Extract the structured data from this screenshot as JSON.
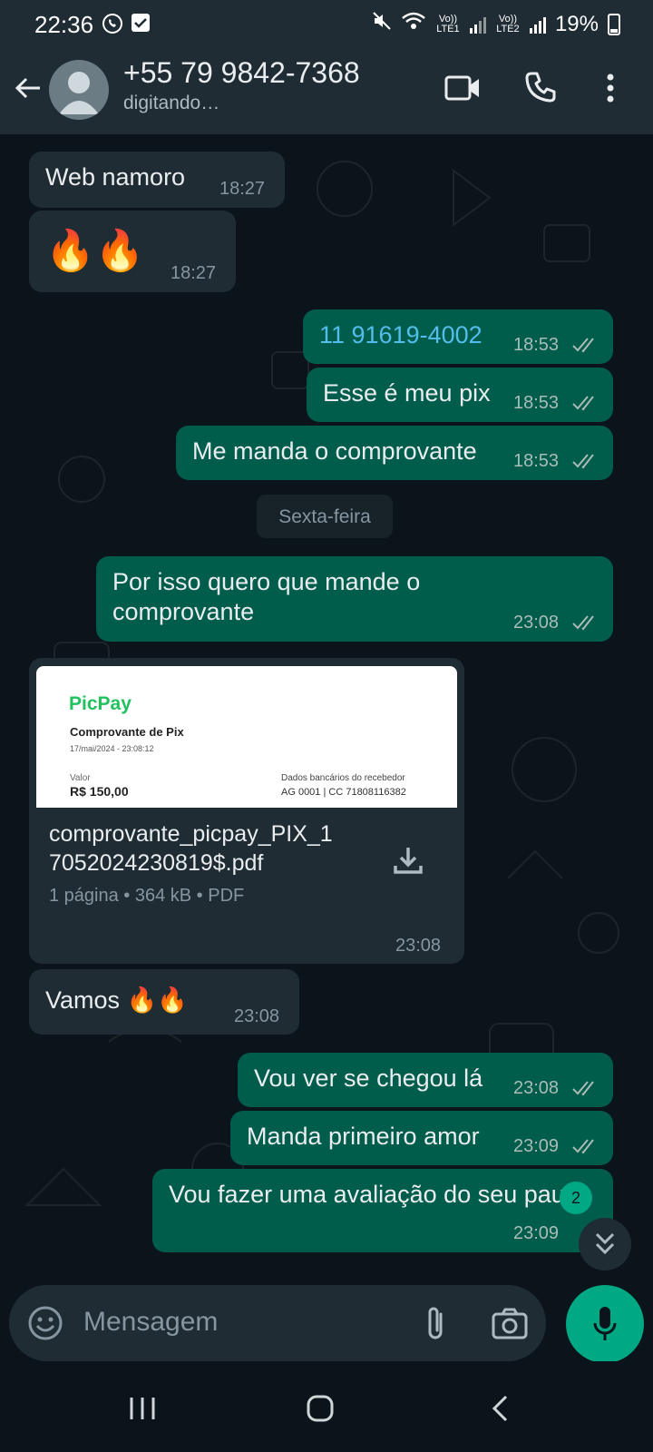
{
  "status_bar": {
    "time": "22:36",
    "battery": "19%",
    "sim1_label": "Vo)) LTE1",
    "sim2_label": "Vo)) LTE2"
  },
  "header": {
    "contact_name": "+55 79 9842-7368",
    "contact_status": "digitando…"
  },
  "messages": [
    {
      "dir": "in",
      "text": "Web namoro",
      "time": "18:27"
    },
    {
      "dir": "in",
      "text": "🔥🔥",
      "time": "18:27"
    },
    {
      "dir": "out",
      "text": "11 91619-4002",
      "time": "18:53",
      "is_link": true
    },
    {
      "dir": "out",
      "text": "Esse é meu pix",
      "time": "18:53"
    },
    {
      "dir": "out",
      "text": "Me manda o comprovante",
      "time": "18:53"
    },
    {
      "dir": "out",
      "text_line1": "Por isso quero que mande o",
      "text_line2": "comprovante",
      "time": "23:08"
    },
    {
      "dir": "in",
      "type": "document",
      "time": "23:08"
    },
    {
      "dir": "in",
      "text": "Vamos 🔥🔥",
      "time": "23:08"
    },
    {
      "dir": "out",
      "text": "Vou ver se chegou lá",
      "time": "23:08"
    },
    {
      "dir": "out",
      "text": "Manda primeiro amor",
      "time": "23:09"
    },
    {
      "dir": "out",
      "text": "Vou fazer uma avaliação do seu pau",
      "time": "23:09"
    }
  ],
  "date_divider": "Sexta-feira",
  "document": {
    "preview_brand": "PicPay",
    "preview_title": "Comprovante de Pix",
    "preview_date": "17/mai/2024 - 23:08:12",
    "preview_value_label": "Valor",
    "preview_value": "R$ 150,00",
    "preview_bank_label": "Dados bancários do recebedor",
    "preview_bank_value": "AG 0001 | CC 71808116382",
    "file_name_line1": "comprovante_picpay_PIX_1",
    "file_name_line2": "7052024230819$.pdf",
    "meta": "1 página • 364 kB • PDF"
  },
  "unread_count": "2",
  "composer": {
    "placeholder": "Mensagem"
  },
  "colors": {
    "background": "#0b141a",
    "header": "#1f2c34",
    "incoming_bubble": "#202c33",
    "outgoing_bubble": "#005c4b",
    "accent": "#00a884",
    "link": "#53bdeb"
  },
  "icons": [
    "whatsapp-icon",
    "checkbox-icon",
    "mute-icon",
    "wifi-icon",
    "signal-icon",
    "battery-icon",
    "back-arrow-icon",
    "video-call-icon",
    "phone-call-icon",
    "more-options-icon",
    "read-ticks-icon",
    "download-icon",
    "emoji-icon",
    "attach-icon",
    "camera-icon",
    "mic-icon",
    "recent-apps-icon",
    "home-icon",
    "nav-back-icon",
    "double-chevron-down-icon"
  ]
}
